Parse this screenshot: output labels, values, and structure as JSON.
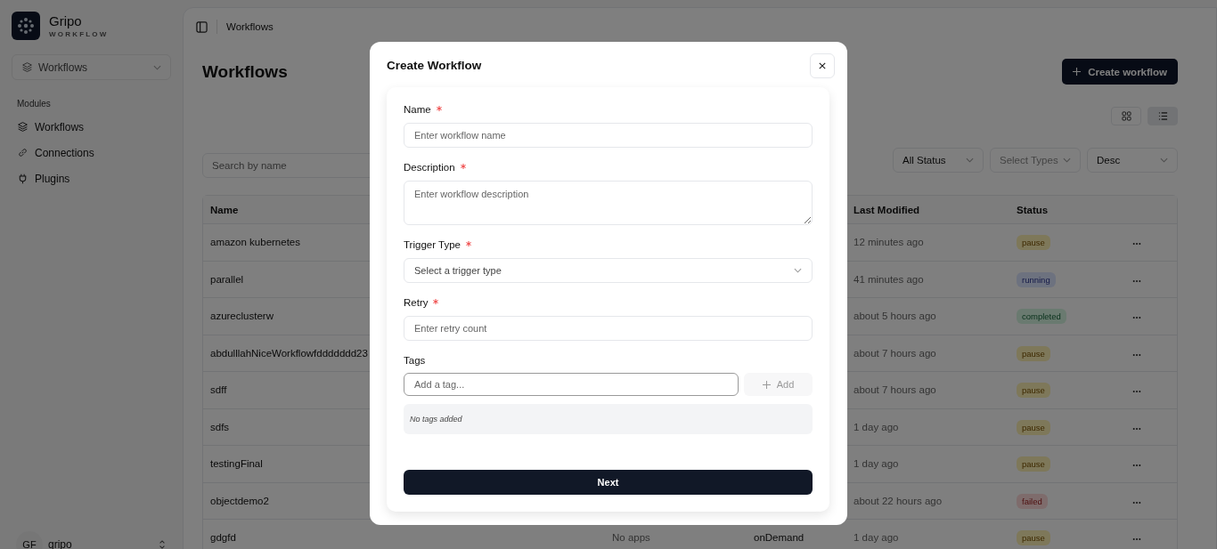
{
  "sidebar": {
    "brand": {
      "name": "Gripo",
      "subtitle": "WORKFLOW"
    },
    "module_select": {
      "value": "Workflows"
    },
    "section_label": "Modules",
    "items": [
      {
        "label": "Workflows"
      },
      {
        "label": "Connections"
      },
      {
        "label": "Plugins"
      }
    ],
    "user": {
      "initials": "GF",
      "name": "gripo"
    }
  },
  "topbar": {
    "breadcrumb": "Workflows"
  },
  "page": {
    "title": "Workflows",
    "create_button": "Create workflow",
    "view_toggle": [
      {
        "kind": "grid",
        "selected": false
      },
      {
        "kind": "list",
        "selected": true
      }
    ],
    "search": {
      "placeholder": "Search by name"
    },
    "filters": [
      {
        "value": "All Status"
      },
      {
        "placeholder": "Select Types"
      },
      {
        "value": "Desc"
      }
    ]
  },
  "table": {
    "columns": [
      "Name",
      "Last Modified",
      "Status"
    ],
    "rows": [
      {
        "name": "amazon kubernetes",
        "last_modified": "12 minutes ago",
        "status": {
          "label": "pause",
          "kind": "warning"
        }
      },
      {
        "name": "parallel",
        "last_modified": "41 minutes ago",
        "status": {
          "label": "running",
          "kind": "info"
        }
      },
      {
        "name": "azureclusterw",
        "last_modified": "about 5 hours ago",
        "status": {
          "label": "completed",
          "kind": "success"
        }
      },
      {
        "name": "abdulllahNiceWorkflowfddddddd23",
        "last_modified": "about 7 hours ago",
        "status": {
          "label": "pause",
          "kind": "warning"
        }
      },
      {
        "name": "sdff",
        "last_modified": "about 7 hours ago",
        "status": {
          "label": "pause",
          "kind": "warning"
        }
      },
      {
        "name": "sdfs",
        "last_modified": "1 day ago",
        "status": {
          "label": "pause",
          "kind": "warning"
        }
      },
      {
        "name": "testingFinal",
        "last_modified": "1 day ago",
        "status": {
          "label": "pause",
          "kind": "warning"
        }
      },
      {
        "name": "objectdemo2",
        "last_modified": "about 22 hours ago",
        "status": {
          "label": "failed",
          "kind": "error"
        }
      },
      {
        "name": "gdgfd",
        "apps": "No apps",
        "trigger": "onDemand",
        "last_modified": "1 day ago",
        "status": {
          "label": "pause",
          "kind": "warning"
        }
      }
    ]
  },
  "modal": {
    "title": "Create Workflow",
    "fields": [
      {
        "kind": "text",
        "label": "Name",
        "required": true,
        "placeholder": "Enter workflow name"
      },
      {
        "kind": "textarea",
        "label": "Description",
        "required": true,
        "placeholder": "Enter workflow description"
      },
      {
        "kind": "select",
        "label": "Trigger Type",
        "required": true,
        "placeholder": "Select a trigger type"
      },
      {
        "kind": "text",
        "label": "Retry",
        "required": true,
        "placeholder": "Enter retry count"
      }
    ],
    "tags": {
      "label": "Tags",
      "placeholder": "Add a tag...",
      "focused": true,
      "add_button": {
        "label": "Add",
        "disabled": true
      },
      "empty_text": "No tags added"
    },
    "submit": "Next"
  }
}
